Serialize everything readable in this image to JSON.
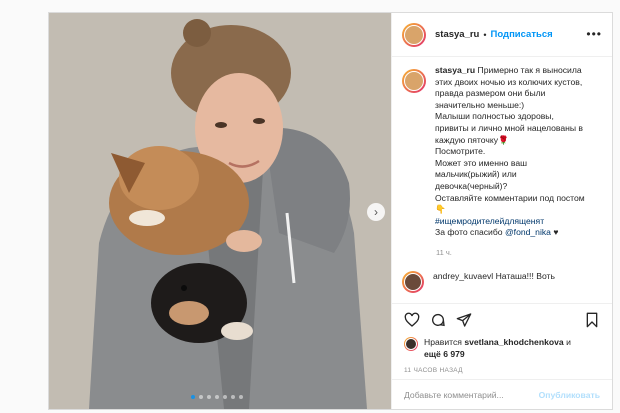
{
  "post": {
    "username": "stasya_ru",
    "separator": "•",
    "follow_label": "Подписаться",
    "more_icon": "more-horizontal-icon"
  },
  "caption": {
    "username": "stasya_ru",
    "line1": "Примерно так я выносила этих двоих ночью из колючих кустов, правда размером они были значительно меньше:)",
    "line2": "Малыши полностью здоровы, привиты и лично мной нацелованы в каждую пяточку🌹",
    "line3": "Посмотрите.",
    "line4": "Может это именно ваш мальчик(рыжий) или девочка(черный)?",
    "line5": "Оставляйте комментарии под постом👇",
    "hashtag": "#ищемродителейдлященят",
    "credit_prefix": "За фото спасибо",
    "mention": "@fond_nika",
    "heart": "♥",
    "time": "11 ч."
  },
  "second_comment": {
    "text": "andrey_kuvaevl Наташа!!! Воть"
  },
  "actions": {
    "like_icon": "heart-icon",
    "comment_icon": "comment-icon",
    "share_icon": "share-icon",
    "save_icon": "bookmark-icon"
  },
  "likes": {
    "prefix": "Нравится",
    "user": "svetlana_khodchenkova",
    "middle": "и",
    "others": "ещё 6 979"
  },
  "timestamp": "11 ЧАСОВ НАЗАД",
  "comment_box": {
    "placeholder": "Добавьте комментарий...",
    "post_label": "Опубликовать"
  },
  "carousel": {
    "next_label": "›",
    "slide_count": 7,
    "active_index": 0
  },
  "colors": {
    "accent": "#0095f6",
    "border": "#dbdbdb"
  }
}
